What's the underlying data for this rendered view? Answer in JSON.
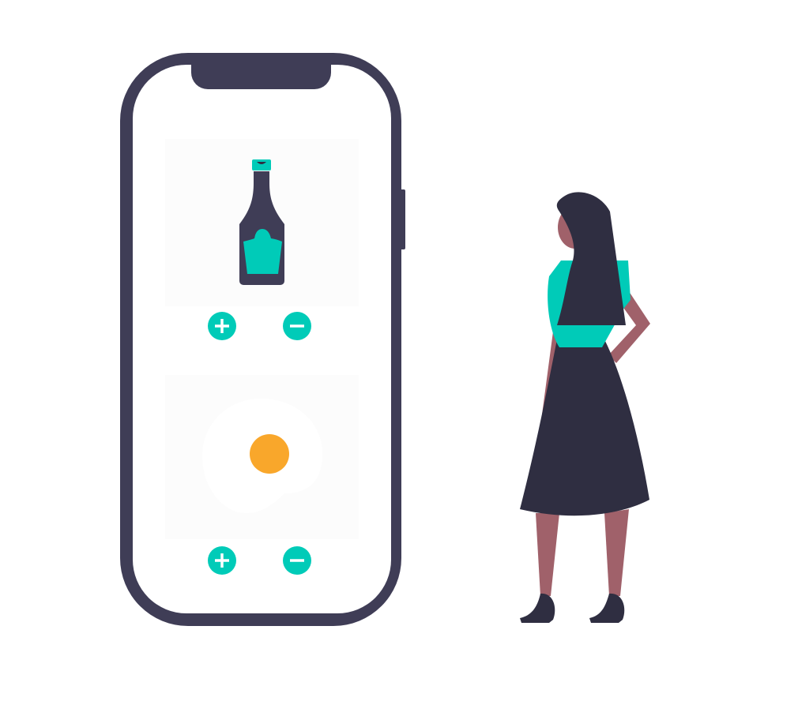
{
  "colors": {
    "phone_frame": "#3f3d56",
    "screen": "#ffffff",
    "card": "#fcfcfc",
    "accent": "#00cbb8",
    "yolk": "#f9a72b",
    "hair_and_skirt": "#2f2e41",
    "skin": "#a0616a"
  },
  "icons": {
    "product_1": "ketchup-bottle-icon",
    "product_2": "fried-egg-icon",
    "add": "plus-icon",
    "remove": "minus-icon"
  }
}
